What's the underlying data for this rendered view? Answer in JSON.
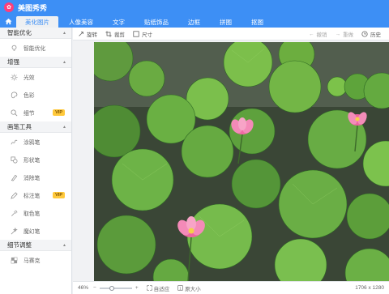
{
  "app": {
    "title": "美图秀秀"
  },
  "tabs": [
    {
      "label": "美化图片",
      "active": true
    },
    {
      "label": "人像美容",
      "active": false
    },
    {
      "label": "文字",
      "active": false
    },
    {
      "label": "贴纸饰品",
      "active": false
    },
    {
      "label": "边框",
      "active": false
    },
    {
      "label": "拼图",
      "active": false
    },
    {
      "label": "抠图",
      "active": false
    }
  ],
  "sidebar": {
    "sections": [
      {
        "title": "智能优化",
        "items": [
          {
            "label": "智能优化",
            "icon": "bulb-icon",
            "vip": false
          }
        ]
      },
      {
        "title": "增强",
        "items": [
          {
            "label": "光效",
            "icon": "sun-icon",
            "vip": false
          },
          {
            "label": "色彩",
            "icon": "palette-icon",
            "vip": false
          },
          {
            "label": "细节",
            "icon": "magnifier-icon",
            "vip": true
          }
        ]
      },
      {
        "title": "画笔工具",
        "items": [
          {
            "label": "涂鸦笔",
            "icon": "scribble-icon",
            "vip": false
          },
          {
            "label": "形状笔",
            "icon": "shape-icon",
            "vip": false
          },
          {
            "label": "消除笔",
            "icon": "eraser-icon",
            "vip": false
          },
          {
            "label": "标注笔",
            "icon": "marker-icon",
            "vip": true
          },
          {
            "label": "取色笔",
            "icon": "picker-icon",
            "vip": false
          },
          {
            "label": "魔幻笔",
            "icon": "magic-icon",
            "vip": false
          }
        ]
      },
      {
        "title": "细节调整",
        "items": [
          {
            "label": "马赛克",
            "icon": "mosaic-icon",
            "vip": false
          }
        ]
      }
    ],
    "vip_label": "VIP"
  },
  "toolbar": {
    "rotate": "旋转",
    "crop": "裁剪",
    "resize": "尺寸",
    "undo": "撤销",
    "redo": "重做",
    "history": "历史"
  },
  "status": {
    "zoom": "46%",
    "fit": "自适应",
    "original": "原大小",
    "dimensions": "1706 x 1280"
  },
  "colors": {
    "brand": "#3d8ff5",
    "vip": "#ffc93c",
    "lotus": "#f06aa4"
  }
}
